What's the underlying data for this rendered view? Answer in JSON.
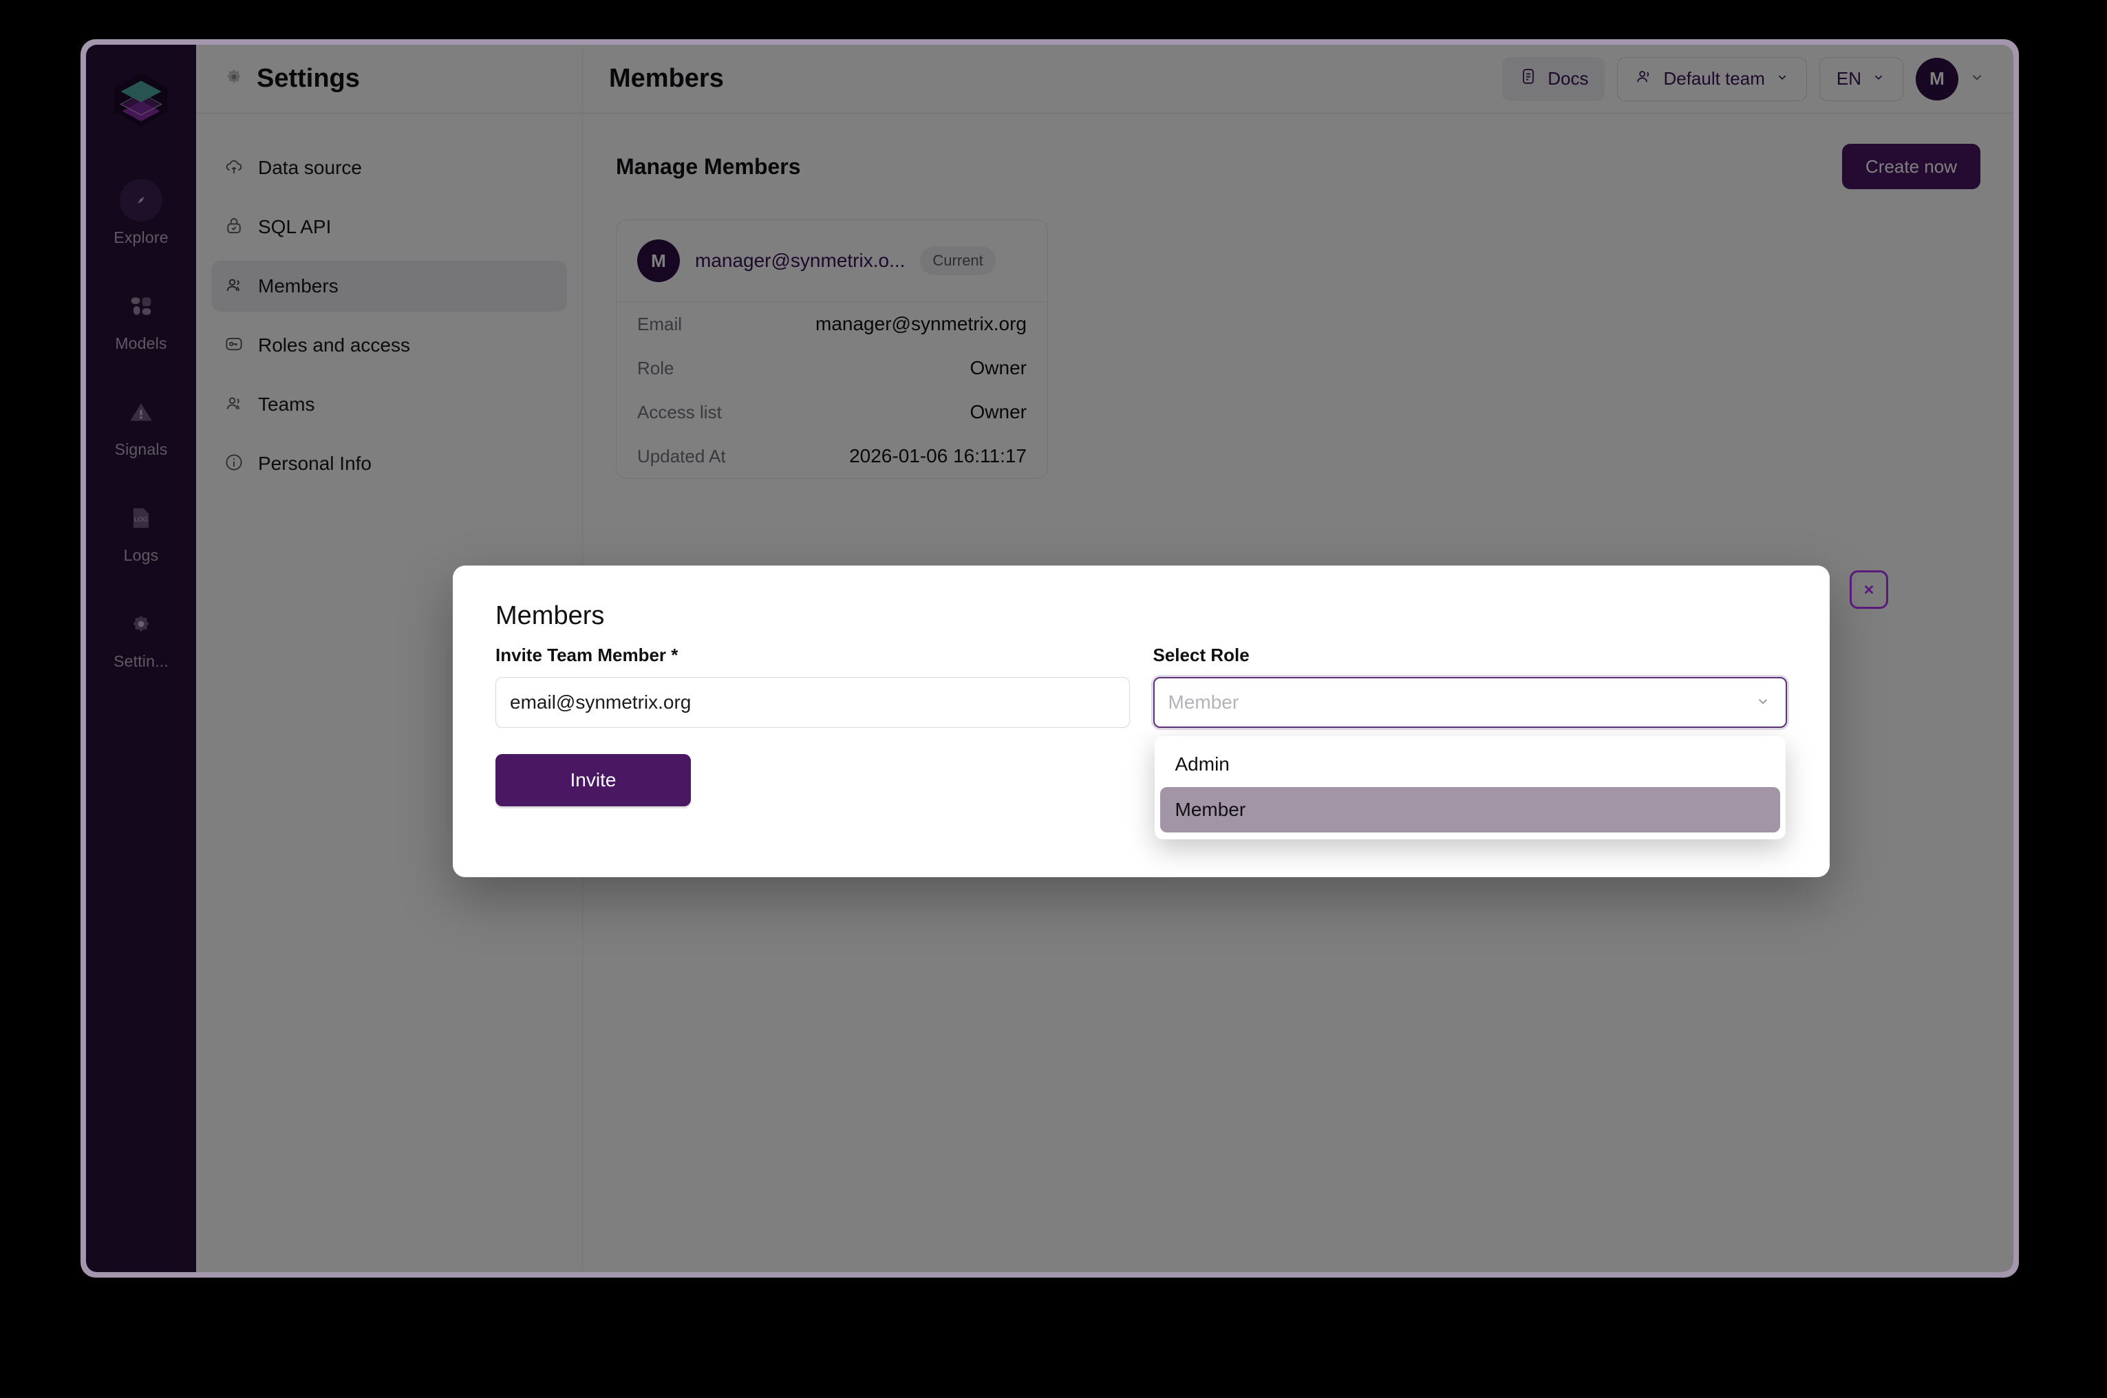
{
  "rail": {
    "logo_icon": "layers-cube-logo",
    "items": [
      {
        "label": "Explore",
        "icon": "compass-icon"
      },
      {
        "label": "Models",
        "icon": "blocks-icon"
      },
      {
        "label": "Signals",
        "icon": "warning-triangle-icon"
      },
      {
        "label": "Logs",
        "icon": "log-document-icon"
      },
      {
        "label": "Settin...",
        "icon": "gear-icon"
      }
    ]
  },
  "settings": {
    "title": "Settings",
    "title_icon": "gear-icon",
    "items": [
      {
        "label": "Data source",
        "icon": "cloud-upload-icon",
        "active": false
      },
      {
        "label": "SQL API",
        "icon": "lock-check-icon",
        "active": false
      },
      {
        "label": "Members",
        "icon": "people-icon",
        "active": true
      },
      {
        "label": "Roles and access",
        "icon": "key-card-icon",
        "active": false
      },
      {
        "label": "Teams",
        "icon": "people-icon",
        "active": false
      },
      {
        "label": "Personal Info",
        "icon": "info-circle-icon",
        "active": false
      }
    ]
  },
  "topbar": {
    "title": "Members",
    "docs_label": "Docs",
    "docs_icon": "document-icon",
    "team_label": "Default team",
    "team_icon": "people-icon",
    "lang_label": "EN",
    "avatar_initial": "M"
  },
  "content": {
    "heading": "Manage Members",
    "create_label": "Create now",
    "member_card": {
      "avatar_initial": "M",
      "email_truncated": "manager@synmetrix.o...",
      "badge": "Current",
      "rows": [
        {
          "key": "Email",
          "value": "manager@synmetrix.org"
        },
        {
          "key": "Role",
          "value": "Owner"
        },
        {
          "key": "Access list",
          "value": "Owner"
        },
        {
          "key": "Updated At",
          "value": "2026-01-06 16:11:17"
        }
      ]
    }
  },
  "modal": {
    "title": "Members",
    "invite_label": "Invite Team Member *",
    "email_placeholder": "email@synmetrix.org",
    "email_value": "",
    "invite_button": "Invite",
    "role_label": "Select Role",
    "role_placeholder": "Member",
    "role_options": [
      {
        "label": "Admin",
        "selected": false
      },
      {
        "label": "Member",
        "selected": true
      }
    ],
    "close_icon": "close-icon"
  },
  "colors": {
    "brand_purple": "#4a1763",
    "rail_bg": "#281238",
    "accent_teal": "#4fa9a0",
    "highlight": "#a295a6"
  }
}
